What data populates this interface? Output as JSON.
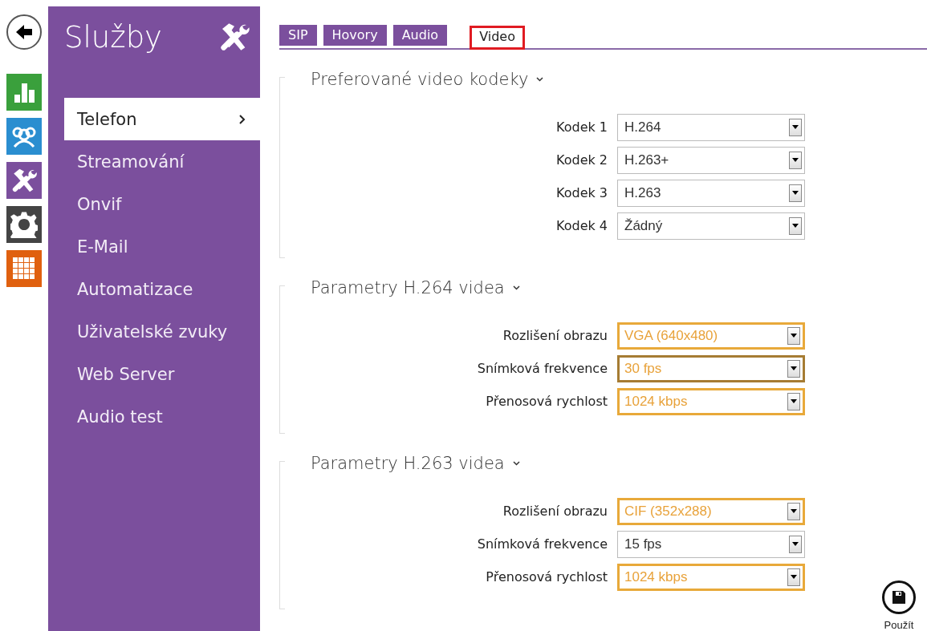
{
  "sidebar": {
    "title": "Služby",
    "items": [
      {
        "label": "Telefon",
        "selected": true
      },
      {
        "label": "Streamování",
        "selected": false
      },
      {
        "label": "Onvif",
        "selected": false
      },
      {
        "label": "E-Mail",
        "selected": false
      },
      {
        "label": "Automatizace",
        "selected": false
      },
      {
        "label": "Uživatelské zvuky",
        "selected": false
      },
      {
        "label": "Web Server",
        "selected": false
      },
      {
        "label": "Audio test",
        "selected": false
      }
    ]
  },
  "tabs": [
    {
      "label": "SIP",
      "selected": false
    },
    {
      "label": "Hovory",
      "selected": false
    },
    {
      "label": "Audio",
      "selected": false
    },
    {
      "label": "Video",
      "selected": true
    }
  ],
  "sections": [
    {
      "title": "Preferované video kodeky",
      "fields": [
        {
          "label": "Kodek 1",
          "value": "H.264",
          "changed": false,
          "focused": false
        },
        {
          "label": "Kodek 2",
          "value": "H.263+",
          "changed": false,
          "focused": false
        },
        {
          "label": "Kodek 3",
          "value": "H.263",
          "changed": false,
          "focused": false
        },
        {
          "label": "Kodek 4",
          "value": "Žádný",
          "changed": false,
          "focused": false
        }
      ]
    },
    {
      "title": "Parametry H.264 videa",
      "fields": [
        {
          "label": "Rozlišení obrazu",
          "value": "VGA (640x480)",
          "changed": true,
          "focused": false
        },
        {
          "label": "Snímková frekvence",
          "value": "30 fps",
          "changed": true,
          "focused": true
        },
        {
          "label": "Přenosová rychlost",
          "value": "1024 kbps",
          "changed": true,
          "focused": false
        }
      ]
    },
    {
      "title": "Parametry H.263 videa",
      "fields": [
        {
          "label": "Rozlišení obrazu",
          "value": "CIF (352x288)",
          "changed": true,
          "focused": false
        },
        {
          "label": "Snímková frekvence",
          "value": "15 fps",
          "changed": false,
          "focused": false
        },
        {
          "label": "Přenosová rychlost",
          "value": "1024 kbps",
          "changed": true,
          "focused": false
        }
      ]
    }
  ],
  "save_button": {
    "label": "Použít"
  }
}
